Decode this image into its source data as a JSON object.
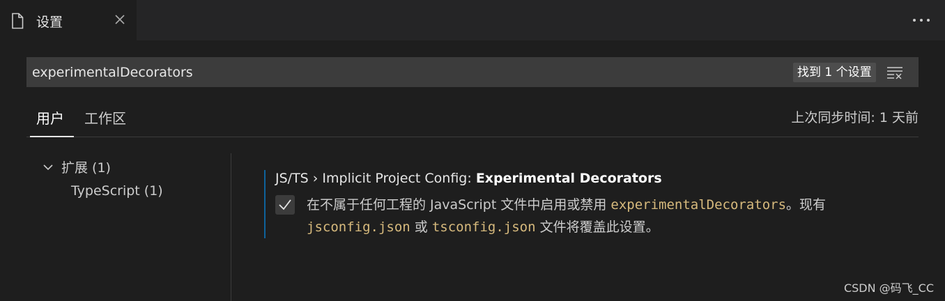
{
  "tab": {
    "title": "设置",
    "icon": "file-icon",
    "close_icon": "close-icon"
  },
  "toolbar": {
    "more_icon": "more-actions-icon"
  },
  "search": {
    "value": "experimentalDecorators",
    "result_count": "找到 1 个设置",
    "clear_icon": "clear-filter-icon"
  },
  "scope_tabs": {
    "user": "用户",
    "workspace": "工作区",
    "active": "user"
  },
  "sync_status": "上次同步时间: 1 天前",
  "toc": {
    "group_label": "扩展 (1)",
    "child_label": "TypeScript (1)"
  },
  "setting": {
    "category": "JS/TS › Implicit Project Config: ",
    "name": "Experimental Decorators",
    "checked": true,
    "desc_part1": "在不属于任何工程的 JavaScript 文件中启用或禁用 ",
    "desc_code1": "experimentalDecorators",
    "desc_part2": "。现有 ",
    "desc_code2": "jsconfig.json",
    "desc_part3": " 或 ",
    "desc_code3": "tsconfig.json",
    "desc_part4": " 文件将覆盖此设置。"
  },
  "watermark": "CSDN @码飞_CC",
  "colors": {
    "accent": "#0e639c",
    "code": "#d7ba7d",
    "background": "#1e1e1e"
  }
}
